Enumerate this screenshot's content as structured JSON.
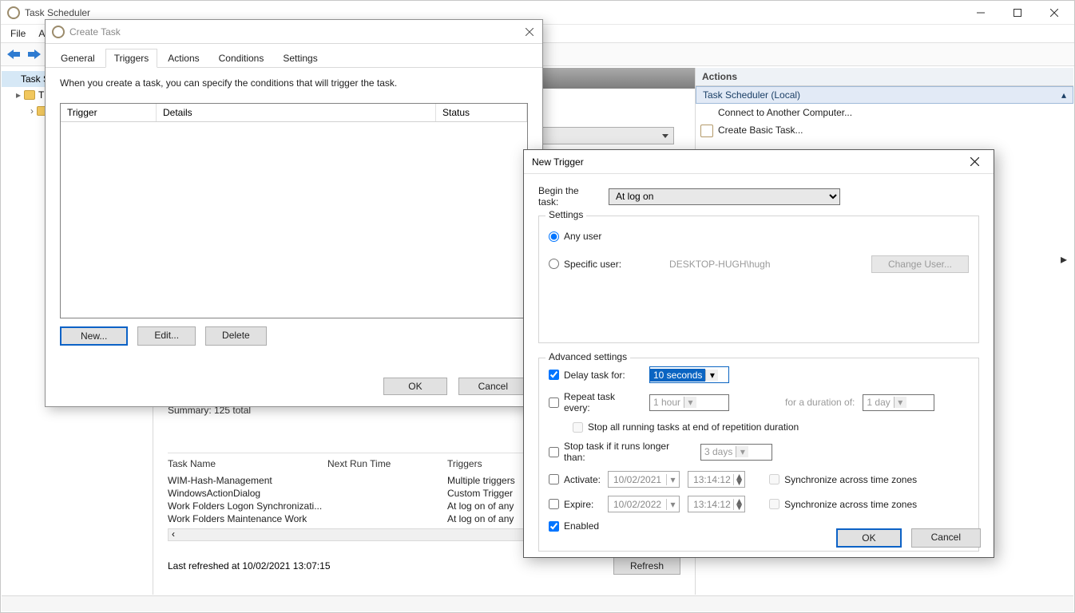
{
  "main": {
    "title": "Task Scheduler",
    "menu": {
      "file": "File",
      "action": "Action"
    },
    "tree": {
      "root": "Task Scheduler",
      "lib_prefix": "T"
    },
    "actions": {
      "header": "Actions",
      "group": "Task Scheduler (Local)",
      "items": [
        "Connect to Another Computer...",
        "Create Basic Task..."
      ]
    },
    "summary": "Summary: 125 total",
    "table": {
      "headers": [
        "Task Name",
        "Next Run Time",
        "Triggers"
      ],
      "rows": [
        {
          "name": "WIM-Hash-Management",
          "next": "",
          "trig": "Multiple triggers"
        },
        {
          "name": "WindowsActionDialog",
          "next": "",
          "trig": "Custom Trigger"
        },
        {
          "name": "Work Folders Logon Synchronizati...",
          "next": "",
          "trig": "At log on of any"
        },
        {
          "name": "Work Folders Maintenance Work",
          "next": "",
          "trig": "At log on of any"
        }
      ]
    },
    "lastRefreshed": "Last refreshed at 10/02/2021 13:07:15",
    "refresh": "Refresh"
  },
  "ct": {
    "title": "Create Task",
    "tabs": [
      "General",
      "Triggers",
      "Actions",
      "Conditions",
      "Settings"
    ],
    "help": "When you create a task, you can specify the conditions that will trigger the task.",
    "cols": [
      "Trigger",
      "Details",
      "Status"
    ],
    "buttons": {
      "new": "New...",
      "edit": "Edit...",
      "delete": "Delete",
      "ok": "OK",
      "cancel": "Cancel"
    }
  },
  "nt": {
    "title": "New Trigger",
    "beginLabel": "Begin the task:",
    "beginValue": "At log on",
    "settingsLegend": "Settings",
    "anyUser": "Any user",
    "specificUser": "Specific user:",
    "userName": "DESKTOP-HUGH\\hugh",
    "changeUser": "Change User...",
    "advLegend": "Advanced settings",
    "delayLabel": "Delay task for:",
    "delayValue": "10 seconds",
    "repeatLabel": "Repeat task every:",
    "repeatValue": "1 hour",
    "durationLabel": "for a duration of:",
    "durationValue": "1 day",
    "stopAll": "Stop all running tasks at end of repetition duration",
    "stopIf": "Stop task if it runs longer than:",
    "stopIfValue": "3 days",
    "activate": "Activate:",
    "activateDate": "10/02/2021",
    "activateTime": "13:14:12",
    "expire": "Expire:",
    "expireDate": "10/02/2022",
    "expireTime": "13:14:12",
    "sync": "Synchronize across time zones",
    "enabled": "Enabled",
    "ok": "OK",
    "cancel": "Cancel"
  }
}
